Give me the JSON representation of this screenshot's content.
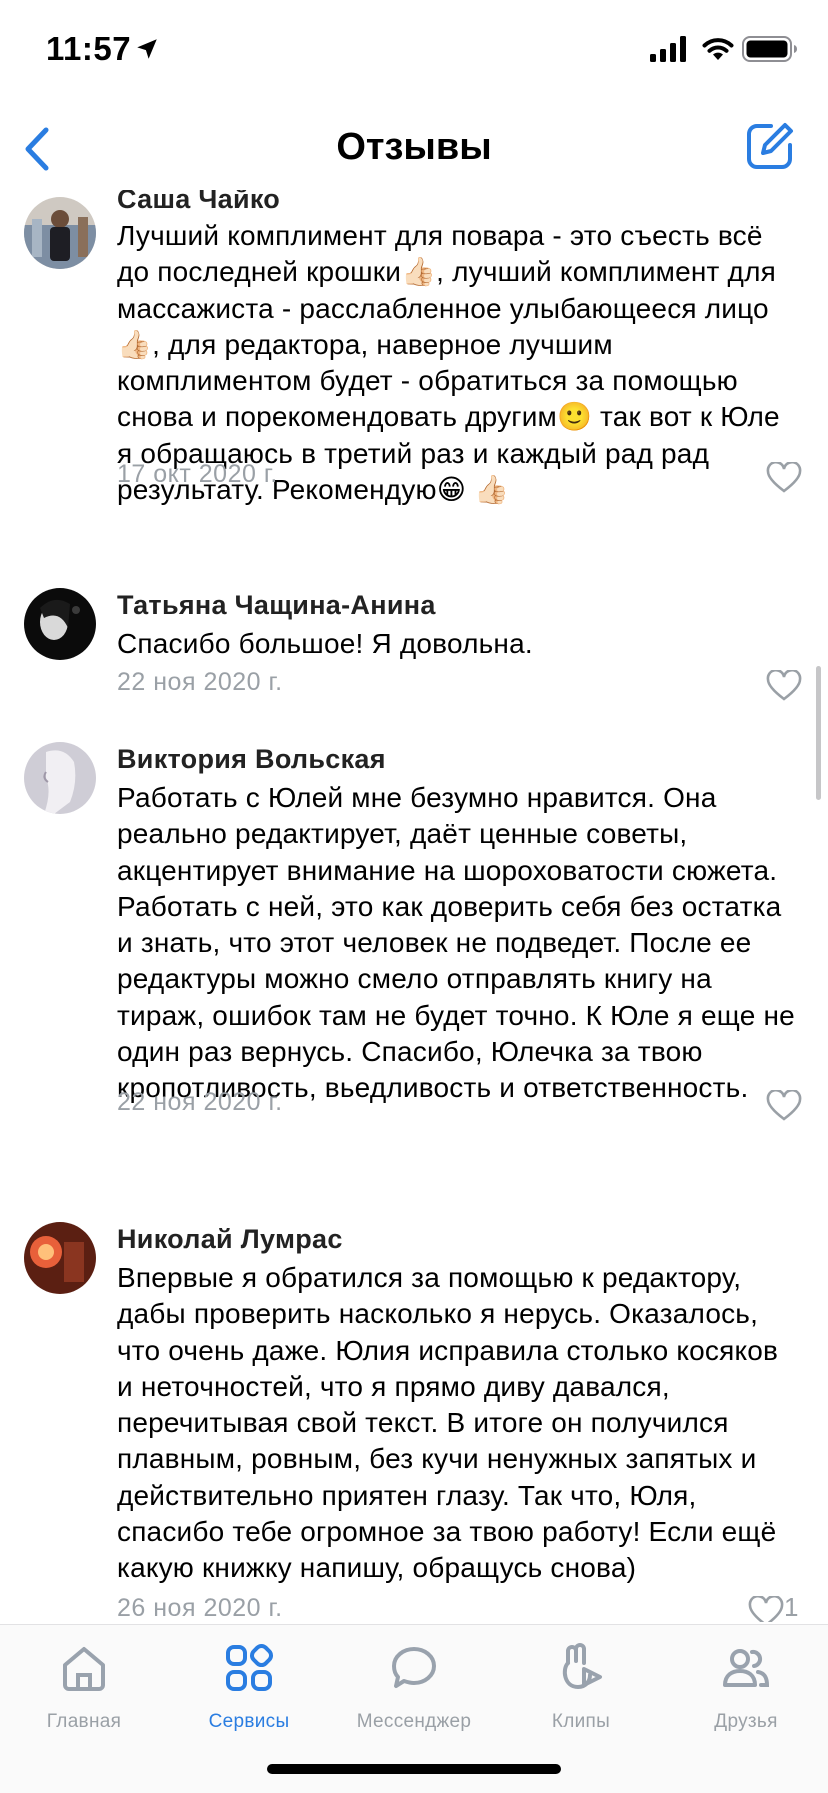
{
  "status_bar": {
    "time": "11:57"
  },
  "header": {
    "title": "Отзывы"
  },
  "colors": {
    "accent": "#2a7de1",
    "muted": "#9aa0a6",
    "icon": "#99a2ad"
  },
  "reviews": [
    {
      "author": "Саша Чайко",
      "text": "Лучший комплимент для повара - это съесть всё до последней крошки👍🏻, лучший комплимент для массажиста - расслабленное улыбающееся лицо👍🏻, для редактора, наверное лучшим комплиментом будет - обратиться за помощью снова и порекомендовать другим🙂 так вот к Юле я обращаюсь в третий раз и каждый рад рад результату. Рекомендую😁 👍🏻",
      "date": "17 окт 2020 г.",
      "likes": ""
    },
    {
      "author": "Татьяна Чащина-Анина",
      "text": "Спасибо большое! Я довольна.",
      "date": "22 ноя 2020 г.",
      "likes": ""
    },
    {
      "author": "Виктория Вольская",
      "text": "Работать с Юлей мне безумно нравится. Она реально редактирует, даёт ценные советы, акцентирует внимание на шороховатости сюжета. Работать с ней, это как доверить себя без остатка и знать, что этот человек не подведет. После ее редактуры можно смело отправлять книгу на тираж, ошибок там не будет точно. К Юле я  еще не один раз вернусь. Спасибо, Юлечка за твою кропотливость, вьедливость и ответственность.",
      "date": "22 ноя 2020 г.",
      "likes": ""
    },
    {
      "author": "Николай Лумрас",
      "text": "Впервые я обратился за помощью к редактору, дабы проверить насколько я нерусь. Оказалось, что очень даже. Юлия исправила столько косяков и неточностей, что я прямо диву давался, перечитывая свой текст. В итоге он получился плавным, ровным, без кучи ненужных запятых и действительно приятен глазу. Так что, Юля, спасибо тебе огромное за твою работу! Если ещё какую книжку напишу, обращусь снова)",
      "date": "26 ноя 2020 г.",
      "likes": "1"
    }
  ],
  "tabs": [
    {
      "label": "Главная",
      "icon": "home-icon"
    },
    {
      "label": "Сервисы",
      "icon": "services-grid-icon"
    },
    {
      "label": "Мессенджер",
      "icon": "chat-bubble-icon"
    },
    {
      "label": "Клипы",
      "icon": "clips-icon"
    },
    {
      "label": "Друзья",
      "icon": "friends-icon"
    }
  ]
}
